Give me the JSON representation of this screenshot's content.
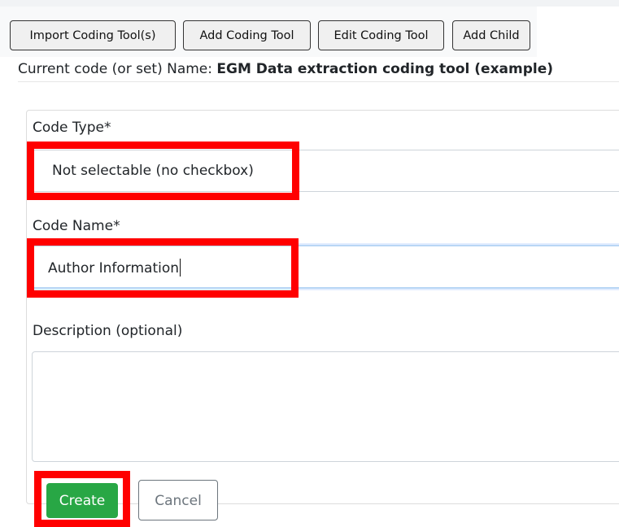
{
  "toolbar": {
    "import_label": "Import Coding Tool(s)",
    "add_label": "Add Coding Tool",
    "edit_label": "Edit Coding Tool",
    "add_child_label": "Add Child"
  },
  "current_code": {
    "prefix": "Current code (or set) Name: ",
    "name": "EGM Data extraction coding tool (example)"
  },
  "form": {
    "code_type_label": "Code Type*",
    "code_type_value": "Not selectable (no checkbox)",
    "code_name_label": "Code Name*",
    "code_name_value": "Author Information",
    "description_label": "Description (optional)",
    "description_value": "",
    "create_label": "Create",
    "cancel_label": "Cancel"
  },
  "colors": {
    "highlight": "#ff0000",
    "create_button": "#28a745",
    "cancel_text": "#6c757d",
    "focus_border": "#b9d6f5"
  },
  "annotations": {
    "highlighted_elements": [
      "code-type-select",
      "code-name-input",
      "create-button"
    ]
  }
}
